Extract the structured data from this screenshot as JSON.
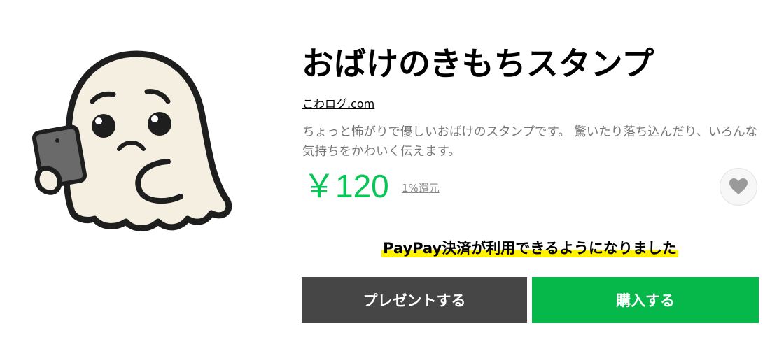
{
  "product": {
    "title": "おばけのきもちスタンプ",
    "author": "こわログ.com",
    "description": "ちょっと怖がりで優しいおばけのスタンプです。 驚いたり落ち込んだり、いろんな気持ちをかわいく伝えます。",
    "price": "￥120",
    "cashback": "1%還元"
  },
  "notice": {
    "paypay": "PayPay決済が利用できるようになりました"
  },
  "actions": {
    "present_label": "プレゼントする",
    "buy_label": "購入する"
  },
  "icons": {
    "favorite": "heart-icon",
    "sticker": "ghost-sticker"
  },
  "colors": {
    "price": "#06c755",
    "buy_button": "#06b84a",
    "present_button": "#464646",
    "highlight": "#fff100"
  }
}
